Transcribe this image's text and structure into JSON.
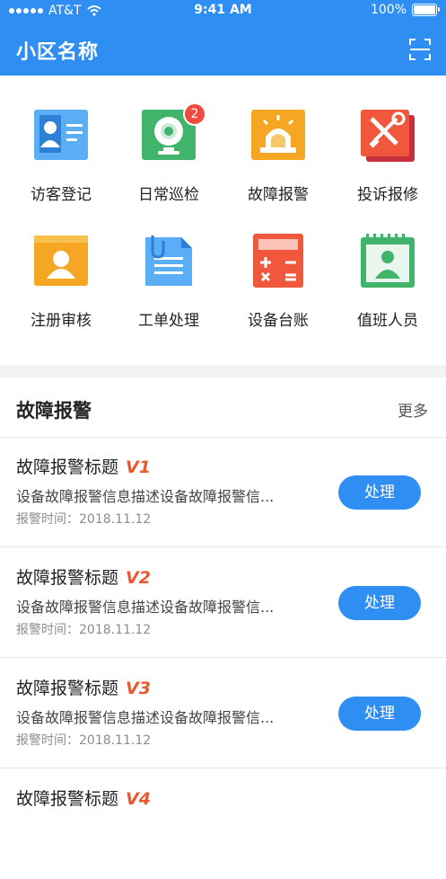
{
  "status_bar": {
    "carrier": "AT&T",
    "time": "9:41 AM",
    "battery": "100%"
  },
  "nav": {
    "title": "小区名称",
    "scan_icon": "scan-icon"
  },
  "grid": [
    {
      "label": "访客登记",
      "icon": "visitor-card-icon"
    },
    {
      "label": "日常巡检",
      "icon": "camera-inspection-icon",
      "badge": "2"
    },
    {
      "label": "故障报警",
      "icon": "alarm-light-icon"
    },
    {
      "label": "投诉报修",
      "icon": "repair-tools-icon"
    },
    {
      "label": "注册审核",
      "icon": "register-review-icon"
    },
    {
      "label": "工单处理",
      "icon": "work-order-icon"
    },
    {
      "label": "设备台账",
      "icon": "calculator-icon"
    },
    {
      "label": "值班人员",
      "icon": "duty-staff-icon"
    }
  ],
  "section": {
    "title": "故障报警",
    "more": "更多"
  },
  "items": [
    {
      "title": "故障报警标题",
      "version": "V1",
      "desc": "设备故障报警信息描述设备故障报警信...",
      "time": "报警时间：2018.11.12",
      "action": "处理"
    },
    {
      "title": "故障报警标题",
      "version": "V2",
      "desc": "设备故障报警信息描述设备故障报警信...",
      "time": "报警时间：2018.11.12",
      "action": "处理"
    },
    {
      "title": "故障报警标题",
      "version": "V3",
      "desc": "设备故障报警信息描述设备故障报警信...",
      "time": "报警时间：2018.11.12",
      "action": "处理"
    },
    {
      "title": "故障报警标题",
      "version": "V4",
      "desc": "",
      "time": "",
      "action": ""
    }
  ],
  "colors": {
    "primary": "#2f8ef2",
    "badge": "#f04b3f",
    "version": "#e9582e"
  }
}
